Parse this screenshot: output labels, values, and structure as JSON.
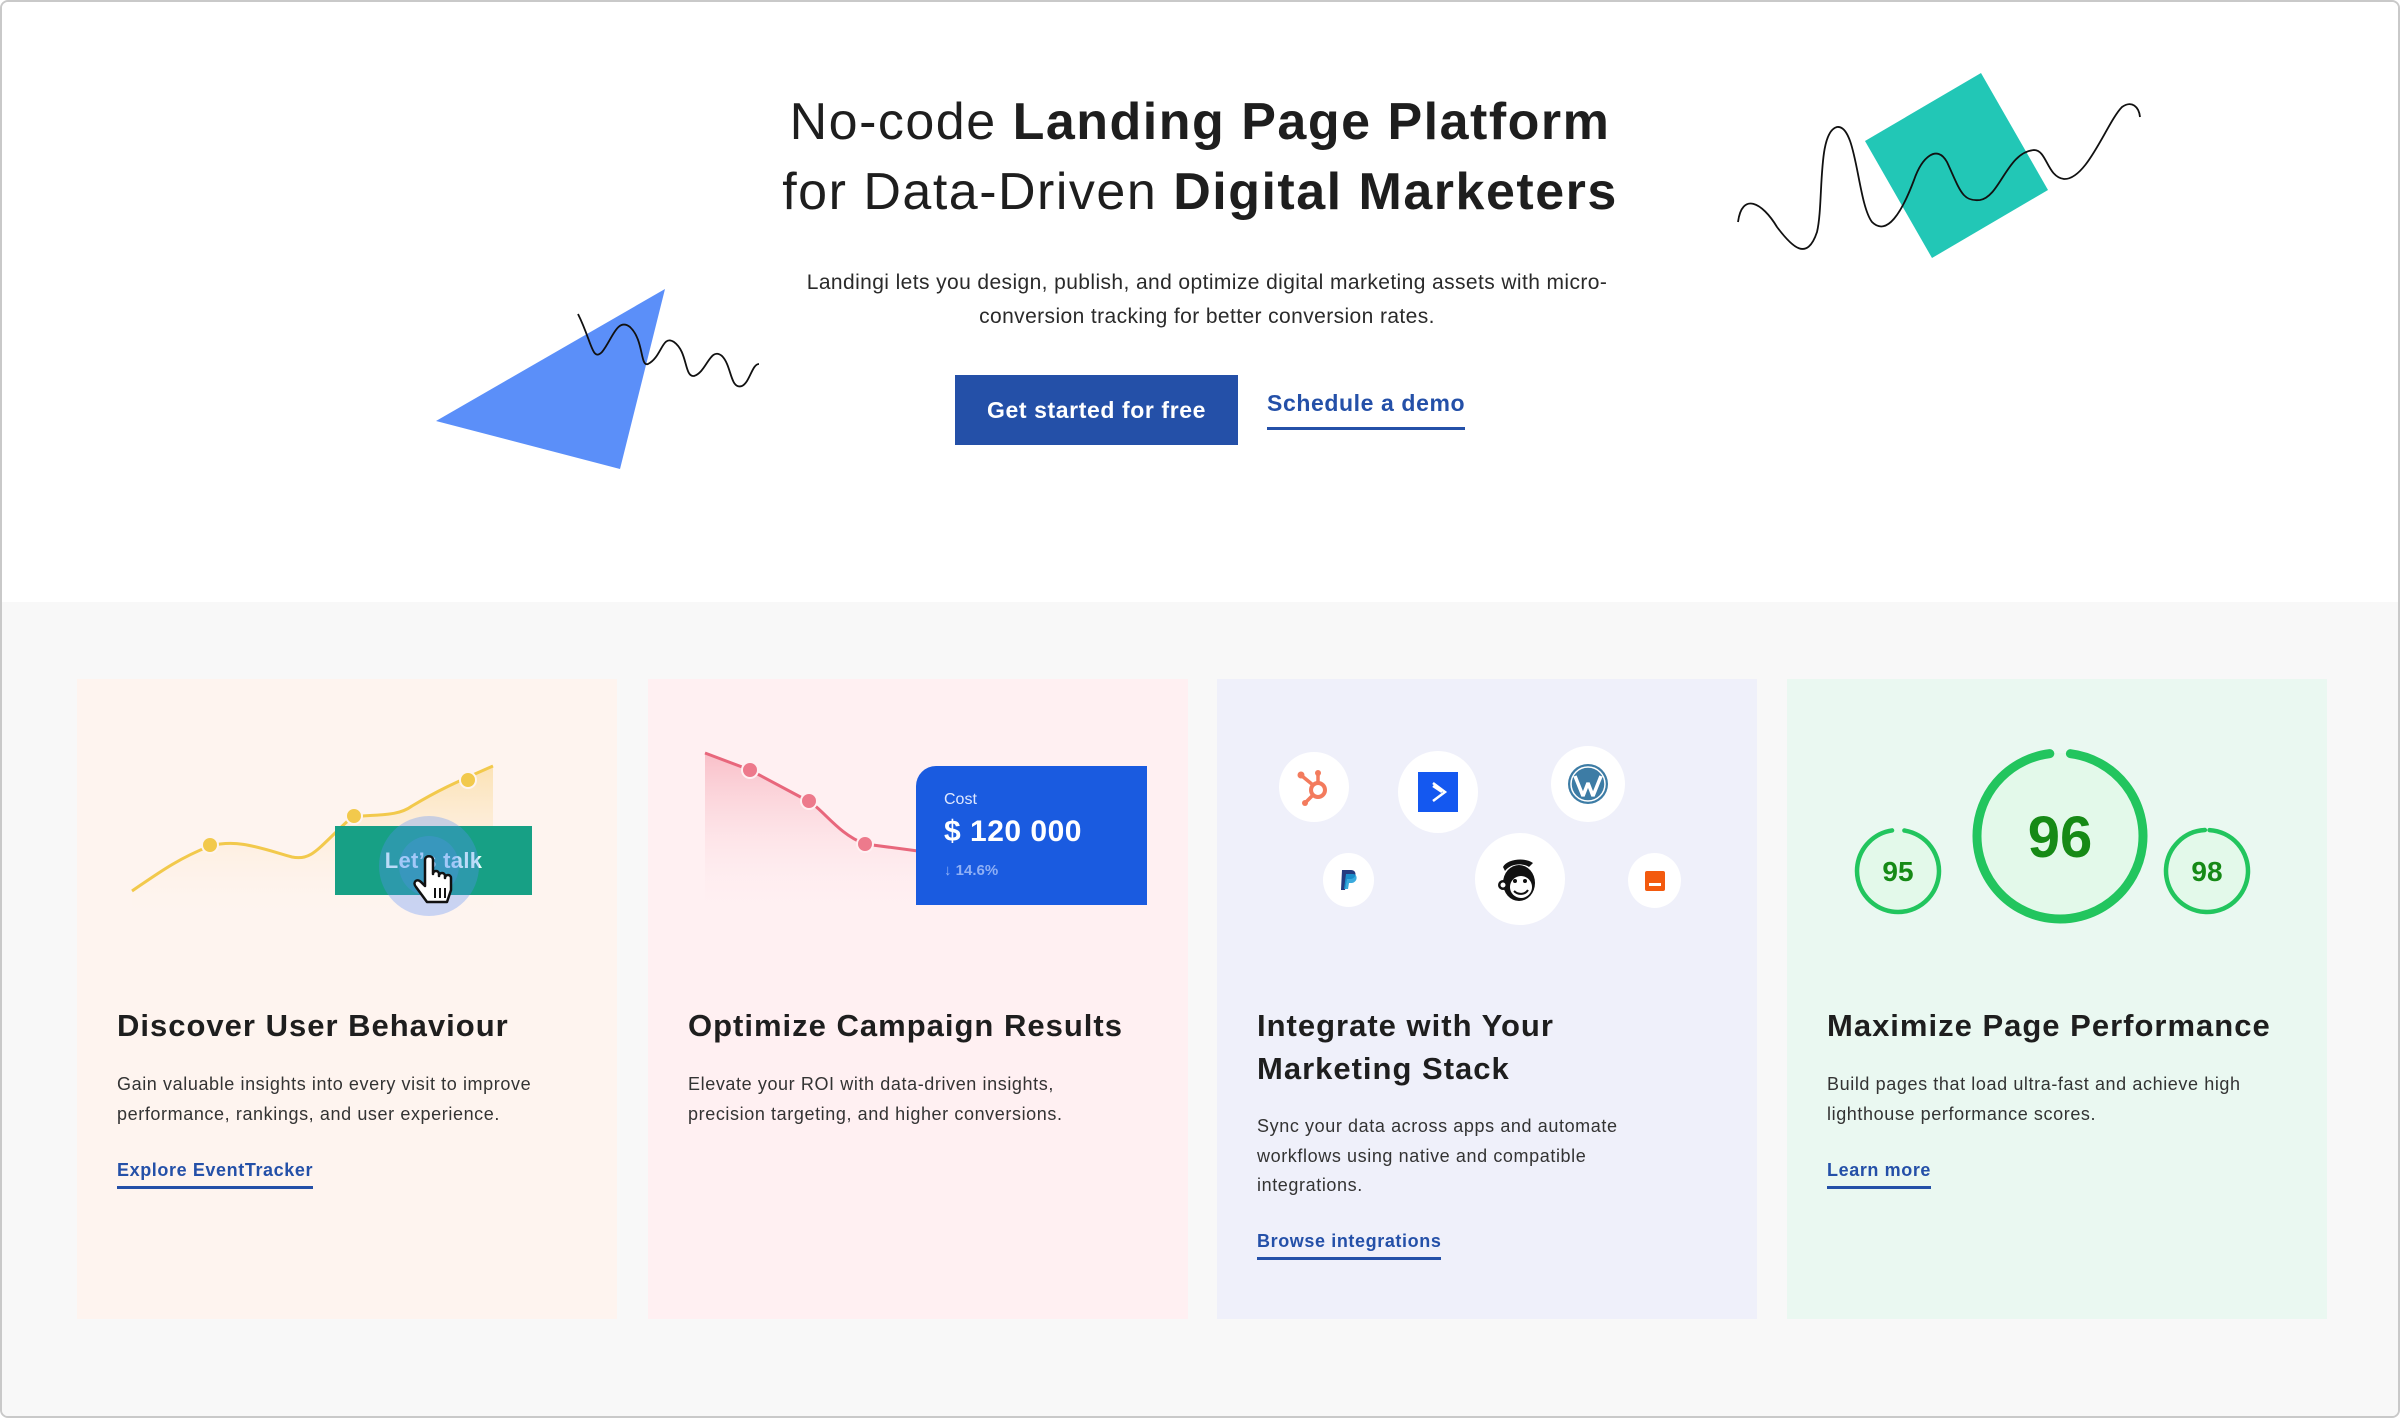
{
  "hero": {
    "title_line1_regular": "No-code ",
    "title_line1_bold": "Landing Page Platform",
    "title_line2_regular": "for Data-Driven ",
    "title_line2_bold": "Digital Marketers",
    "subtitle_line1": "Landingi lets you design, publish, and optimize digital marketing assets with micro-",
    "subtitle_line2": "conversion tracking for better conversion rates.",
    "primary_button": "Get started for free",
    "secondary_link": "Schedule a demo"
  },
  "colors": {
    "brand_blue": "#2450a8",
    "triangle_blue": "#5b8ff9",
    "square_teal": "#22c7b6",
    "cost_card_blue": "#1a5be0",
    "lets_talk_green": "#17a085",
    "score_green": "#22c55e"
  },
  "cards": [
    {
      "title": "Discover User Behaviour",
      "desc_lines": [
        "Gain valuable insights into every visit to improve",
        "performance, rankings, and user experience."
      ],
      "link": "Explore EventTracker",
      "visual": {
        "button_label": "Let’s talk",
        "icon": "hand-pointer-icon"
      }
    },
    {
      "title": "Optimize Campaign Results",
      "desc_lines": [
        "Elevate your ROI with data-driven insights,",
        "precision targeting, and higher conversions."
      ],
      "visual": {
        "cost_label": "Cost",
        "cost_value": "$ 120 000",
        "cost_change": "14.6%",
        "change_icon": "arrow-down-icon"
      }
    },
    {
      "title_lines": [
        "Integrate with Your",
        "Marketing Stack"
      ],
      "desc_lines": [
        "Sync your data across apps and automate",
        "workflows using native and compatible",
        "integrations."
      ],
      "link": "Browse integrations",
      "visual": {
        "logos": [
          "hubspot-icon",
          "activecampaign-icon",
          "wordpress-icon",
          "paypal-icon",
          "mailchimp-icon",
          "smartlook-icon"
        ]
      }
    },
    {
      "title": "Maximize Page Performance",
      "desc_lines": [
        "Build pages that load ultra-fast and achieve high",
        "lighthouse performance scores."
      ],
      "link": "Learn more",
      "visual": {
        "scores": [
          95,
          96,
          98
        ]
      }
    }
  ]
}
